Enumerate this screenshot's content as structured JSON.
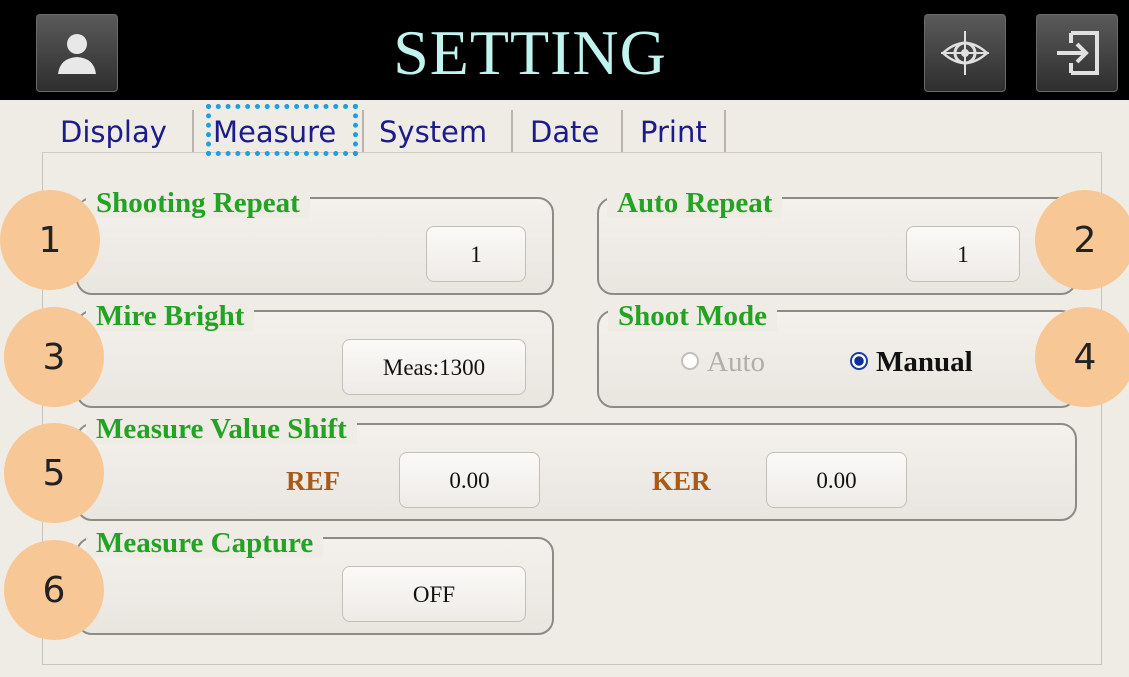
{
  "header": {
    "title": "SETTING",
    "user_icon": "user-icon",
    "target_icon": "target-icon",
    "exit_icon": "exit-icon"
  },
  "tabs": [
    {
      "label": "Display"
    },
    {
      "label": "Measure",
      "active": true
    },
    {
      "label": "System"
    },
    {
      "label": "Date"
    },
    {
      "label": "Print"
    }
  ],
  "settings": {
    "shooting_repeat": {
      "label": "Shooting Repeat",
      "value": "1"
    },
    "auto_repeat": {
      "label": "Auto Repeat",
      "value": "1"
    },
    "mire_bright": {
      "label": "Mire Bright",
      "value": "Meas:1300"
    },
    "shoot_mode": {
      "label": "Shoot Mode",
      "options": [
        "Auto",
        "Manual"
      ],
      "selected": "Manual"
    },
    "measure_value_shift": {
      "label": "Measure Value Shift",
      "ref_label": "REF",
      "ref_value": "0.00",
      "ker_label": "KER",
      "ker_value": "0.00"
    },
    "measure_capture": {
      "label": "Measure Capture",
      "value": "OFF"
    }
  },
  "callouts": [
    "1",
    "2",
    "3",
    "4",
    "5",
    "6"
  ],
  "colors": {
    "accent_tab_outline": "#1aa1e0",
    "group_label": "#23a323",
    "shift_label": "#a85a18",
    "callout": "#f7c796"
  }
}
